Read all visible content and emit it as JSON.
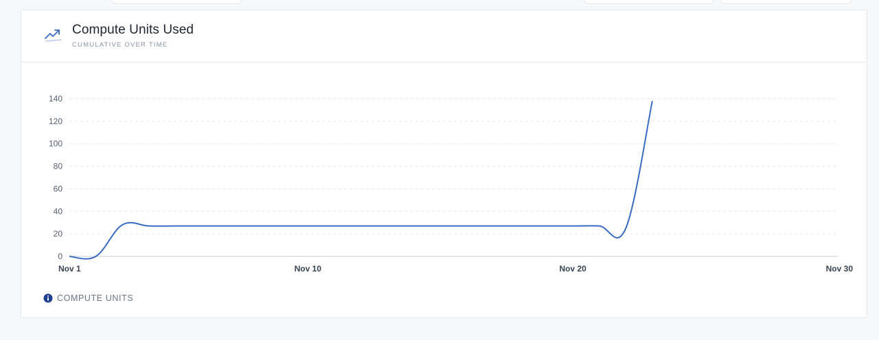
{
  "card": {
    "title": "Compute Units Used",
    "subtitle": "CUMULATIVE OVER TIME",
    "icon": "trending-up-icon",
    "legend_label": "COMPUTE UNITS",
    "legend_icon": "info-icon"
  },
  "colors": {
    "line": "#3a6bc4",
    "accent_icon": "#3a6bc4",
    "info_icon": "#1f3f8f",
    "grid": "#e3e6ec",
    "axis": "#c9ced8",
    "tick_text": "#555d6e"
  },
  "chart_data": {
    "type": "line",
    "title": "Compute Units Used",
    "subtitle": "CUMULATIVE OVER TIME",
    "xlabel": "",
    "ylabel": "",
    "x_ticks": [
      {
        "label": "Nov 1",
        "day": 1
      },
      {
        "label": "Nov 10",
        "day": 10
      },
      {
        "label": "Nov 20",
        "day": 20
      },
      {
        "label": "Nov 30",
        "day": 30
      }
    ],
    "y_ticks": [
      0,
      20,
      40,
      60,
      80,
      100,
      120,
      140
    ],
    "xlim": [
      1,
      30
    ],
    "ylim": [
      0,
      140
    ],
    "grid": true,
    "legend": "bottom-left",
    "series": [
      {
        "name": "COMPUTE UNITS",
        "x": [
          1,
          2,
          3,
          4,
          5,
          6,
          7,
          8,
          9,
          10,
          11,
          12,
          13,
          14,
          15,
          16,
          17,
          18,
          19,
          20,
          21,
          22,
          23
        ],
        "values": [
          0,
          0,
          28,
          27,
          27,
          27,
          27,
          27,
          27,
          27,
          27,
          27,
          27,
          27,
          27,
          27,
          27,
          27,
          27,
          27,
          27,
          25,
          138
        ]
      }
    ]
  }
}
